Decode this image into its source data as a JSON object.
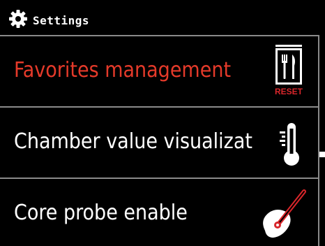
{
  "header": {
    "title": "Settings",
    "icon": "gear-icon"
  },
  "menu": {
    "items": [
      {
        "label": "Favorites management",
        "icon": "cutlery-reset-icon",
        "icon_caption": "RESET",
        "selected": true
      },
      {
        "label": "Chamber value visualizat",
        "icon": "thermometer-icon",
        "selected": false
      },
      {
        "label": "Core probe enable",
        "icon": "core-probe-icon",
        "selected": false
      }
    ]
  },
  "colors": {
    "background": "#000000",
    "text": "#ffffff",
    "selected_text": "#e53a2a",
    "accent_red": "#d9262b",
    "divider": "#8a8a8a"
  }
}
